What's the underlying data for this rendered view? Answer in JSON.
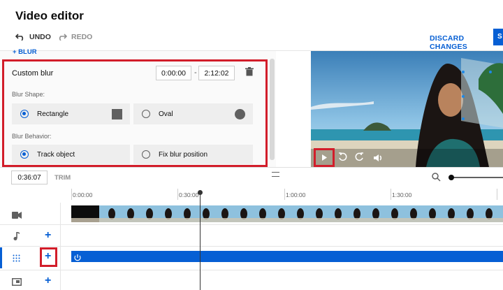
{
  "header": {
    "title": "Video editor",
    "undo": "UNDO",
    "redo": "REDO",
    "discard": "DISCARD CHANGES",
    "save": "S"
  },
  "blur_link": "+ BLUR",
  "blur_panel": {
    "title": "Custom blur",
    "start": "0:00:00",
    "dash": "-",
    "end": "2:12:02",
    "shape_label": "Blur Shape:",
    "behavior_label": "Blur Behavior:",
    "shapes": [
      {
        "label": "Rectangle",
        "selected": true
      },
      {
        "label": "Oval",
        "selected": false
      }
    ],
    "behaviors": [
      {
        "label": "Track object",
        "selected": true
      },
      {
        "label": "Fix blur position",
        "selected": false
      }
    ]
  },
  "timeline": {
    "current_time": "0:36:07",
    "trim": "TRIM",
    "ruler": [
      "0:00:00",
      "0:30:00",
      "1:00:00",
      "1:30:00"
    ]
  },
  "icons": {
    "undo": "undo-icon",
    "redo": "redo-icon",
    "trash": "trash-icon",
    "play": "play-icon",
    "rewind": "rewind-icon",
    "forward": "forward-icon",
    "volume": "volume-icon",
    "zoom": "zoom-icon",
    "video": "video-track-icon",
    "music": "music-track-icon",
    "blur": "blur-track-icon",
    "endscreen": "endscreen-track-icon"
  },
  "colors": {
    "accent": "#065fd4",
    "highlight": "#d21d2a"
  }
}
